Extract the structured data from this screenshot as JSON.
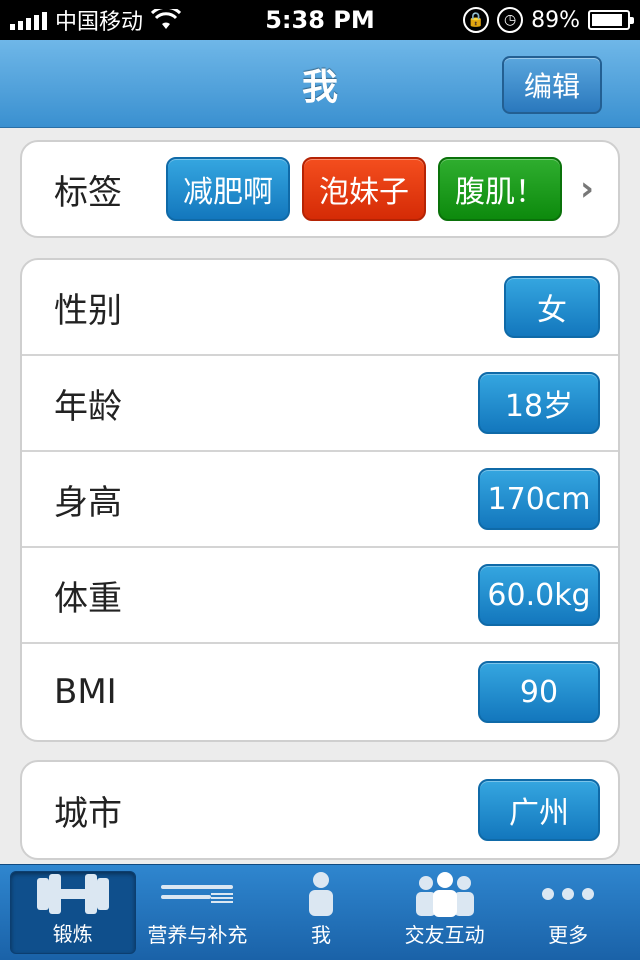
{
  "status_bar": {
    "carrier": "中国移动",
    "time": "5:38 PM",
    "battery": "89%",
    "battery_level": 0.89
  },
  "nav": {
    "title": "我",
    "edit_label": "编辑"
  },
  "tags": {
    "label": "标签",
    "items": [
      {
        "text": "减肥啊",
        "color": "#1377bd"
      },
      {
        "text": "泡妹子",
        "color": "#d52b06"
      },
      {
        "text": "腹肌！",
        "color": "#0d8a0d"
      }
    ]
  },
  "profile": {
    "rows": [
      {
        "label": "性别",
        "value": "女"
      },
      {
        "label": "年龄",
        "value": "18岁"
      },
      {
        "label": "身高",
        "value": "170cm"
      },
      {
        "label": "体重",
        "value": "60.0kg"
      },
      {
        "label": "BMI",
        "value": "90"
      }
    ]
  },
  "location": {
    "label": "城市",
    "value": "广州"
  },
  "tab_bar": {
    "tabs": [
      {
        "label": "锻炼",
        "icon": "dumbbell-icon",
        "active": true
      },
      {
        "label": "营养与补充",
        "icon": "knife-fork-icon",
        "active": false
      },
      {
        "label": "我",
        "icon": "person-icon",
        "active": false
      },
      {
        "label": "交友互动",
        "icon": "group-icon",
        "active": false
      },
      {
        "label": "更多",
        "icon": "more-dots-icon",
        "active": false
      }
    ]
  }
}
